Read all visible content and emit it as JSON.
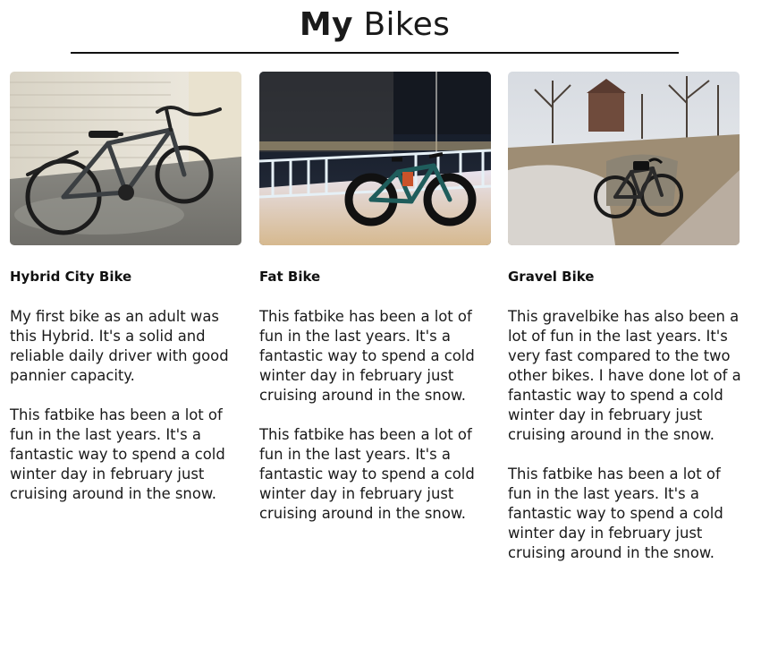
{
  "header": {
    "title_first": "My",
    "title_second": "Bikes"
  },
  "cards": [
    {
      "title": "Hybrid City Bike",
      "photo_icon": "bike-photo",
      "paragraphs": [
        "My first bike as an adult was this Hybrid. It's a solid and reliable daily driver with good pannier capacity.",
        "This fatbike has been a lot of fun in the last years. It's a fantastic way to spend a cold winter day in february just cruising around in the snow."
      ]
    },
    {
      "title": "Fat Bike",
      "photo_icon": "bike-photo",
      "paragraphs": [
        "This fatbike has been a lot of fun in the last years. It's a fantastic way to spend a cold winter day in february just cruising around in the snow.",
        "This fatbike has been a lot of fun in the last years. It's a fantastic way to spend a cold winter day in february just cruising around in the snow."
      ]
    },
    {
      "title": "Gravel Bike",
      "photo_icon": "bike-photo",
      "paragraphs": [
        "This gravelbike has also been a lot of fun in the last years. It's very fast compared to the two other bikes. I have done lot of a fantastic way to spend a cold winter day in february just cruising around in the snow.",
        "This fatbike has been a lot of fun in the last years. It's a fantastic way to spend a cold winter day in february just cruising around in the snow."
      ]
    }
  ]
}
